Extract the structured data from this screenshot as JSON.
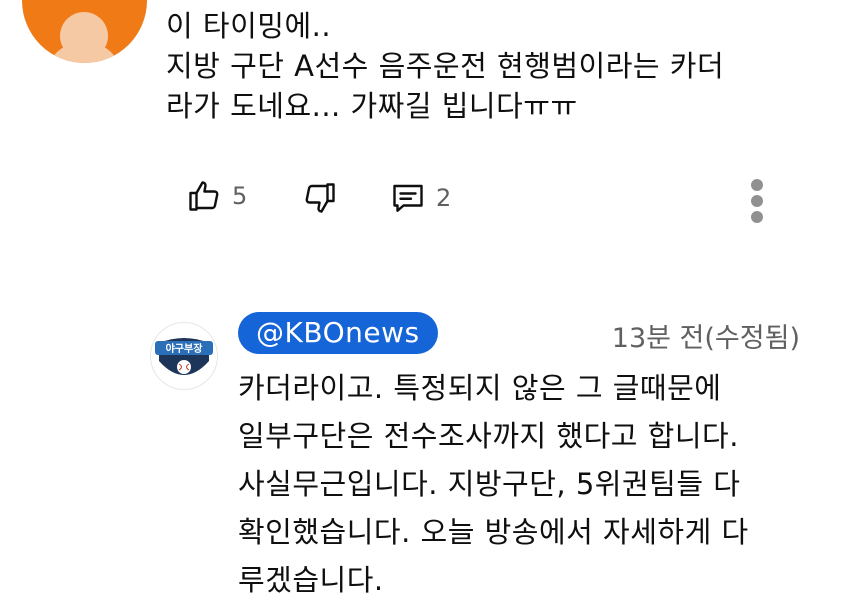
{
  "comment": {
    "lines": [
      "이 타이밍에..",
      "지방 구단 A선수 음주운전 현행범이라는 카더",
      "라가 도네요... 가짜길 빕니다ㅠㅠ"
    ],
    "like_count": "5",
    "reply_count": "2",
    "icons": [
      "thumb-up-icon",
      "thumb-down-icon",
      "reply-icon",
      "more-vertical-icon"
    ]
  },
  "reply": {
    "handle": "@KBOnews",
    "timestamp": "13분 전(수정됨)",
    "avatar_text": "야구부장",
    "lines": [
      "카더라이고. 특정되지 않은 그 글때문에",
      "일부구단은 전수조사까지 했다고 합니다.",
      "사실무근입니다. 지방구단, 5위권팀들 다",
      "확인했습니다. 오늘 방송에서 자세하게 다",
      "루겠습니다."
    ]
  },
  "colors": {
    "avatar_orange": "#f07a16",
    "chip_blue": "#1565d8",
    "secondary_text": "#606060"
  }
}
